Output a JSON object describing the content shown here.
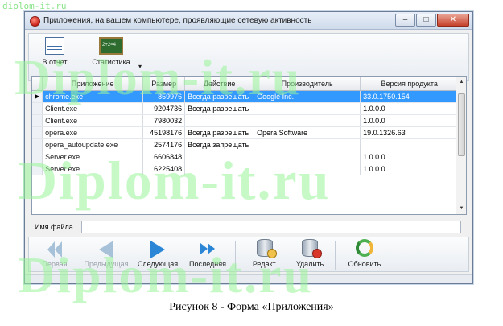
{
  "watermark": {
    "small": "diplom-it.ru",
    "big": "Diplom-it.ru"
  },
  "window": {
    "title": "Приложения, на вашем компьютере, проявляющие сетевую активность",
    "controls": {
      "minimize": "–",
      "maximize": "□",
      "close": "✕"
    }
  },
  "toolbar": {
    "report_label": "В отчет",
    "stats_label": "Статистика",
    "dropdown_glyph": "▾"
  },
  "grid": {
    "columns": [
      "Приложение",
      "Размер",
      "Действие",
      "Производитель",
      "Версия продукта"
    ],
    "row_indicator": "▶",
    "rows": [
      {
        "name": "chrome.exe",
        "size": "859976",
        "action": "Всегда разрешать",
        "vendor": "Google Inc.",
        "version": "33.0.1750.154",
        "selected": true
      },
      {
        "name": "Client.exe",
        "size": "9204736",
        "action": "Всегда разрешать",
        "vendor": "",
        "version": "1.0.0.0"
      },
      {
        "name": "Client.exe",
        "size": "7980032",
        "action": "",
        "vendor": "",
        "version": "1.0.0.0"
      },
      {
        "name": "opera.exe",
        "size": "45198176",
        "action": "Всегда разрешать",
        "vendor": "Opera Software",
        "version": "19.0.1326.63"
      },
      {
        "name": "opera_autoupdate.exe",
        "size": "2574176",
        "action": "Всегда запрещать",
        "vendor": "",
        "version": ""
      },
      {
        "name": "Server.exe",
        "size": "6606848",
        "action": "",
        "vendor": "",
        "version": "1.0.0.0"
      },
      {
        "name": "Server.exe",
        "size": "6225408",
        "action": "",
        "vendor": "",
        "version": "1.0.0.0"
      }
    ]
  },
  "filename": {
    "label": "Имя файла",
    "value": ""
  },
  "nav": {
    "first": "Первая",
    "prev": "Предыдущая",
    "next": "Следующая",
    "last": "Последняя",
    "edit": "Редакт.",
    "delete": "Удалить",
    "refresh": "Обновить"
  },
  "caption": "Рисунок 8 - Форма «Приложения»"
}
